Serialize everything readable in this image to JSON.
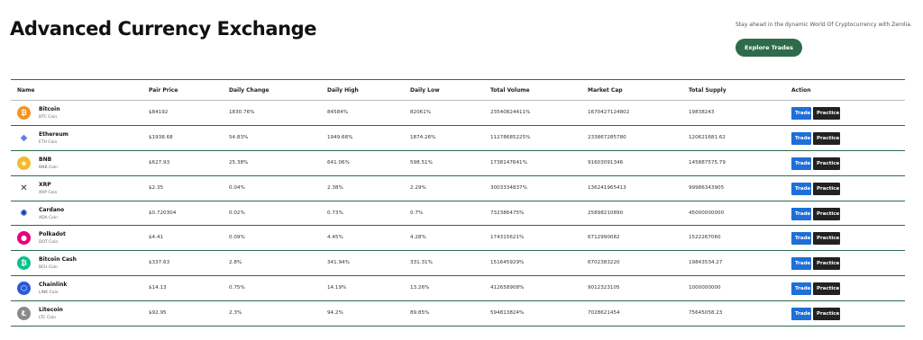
{
  "header": {
    "title": "Advanced Currency Exchange",
    "tagline": "Stay ahead in the dynamic World Of Cryptocurrency with Zerolia.",
    "explore_label": "Explore Trades"
  },
  "table": {
    "columns": [
      "Name",
      "Pair Price",
      "Daily Change",
      "Daily High",
      "Daily Low",
      "Total Volume",
      "Market Cap",
      "Total Supply",
      "Action"
    ],
    "trade_label": "Trade",
    "practice_label": "Practice",
    "rows": [
      {
        "name": "Bitcoin",
        "symbol": "BTC Coin",
        "icon": "bitcoin-icon",
        "color": "#f7931a",
        "glyph": "₿",
        "price": "$84192",
        "change": "1830.76%",
        "high": "84584%",
        "low": "82061%",
        "volume": "23540824411%",
        "cap": "1670427124802",
        "supply": "19838243"
      },
      {
        "name": "Ethereum",
        "symbol": "ETH Coin",
        "icon": "ethereum-icon",
        "color": "#ffffff",
        "glyph": "◆",
        "price": "$1938.68",
        "change": "54.83%",
        "high": "1949.66%",
        "low": "1874.26%",
        "volume": "11278685225%",
        "cap": "233867285780",
        "supply": "120621681.62"
      },
      {
        "name": "BNB",
        "symbol": "BNB Coin",
        "icon": "bnb-icon",
        "color": "#f3ba2f",
        "glyph": "◈",
        "price": "$627.93",
        "change": "25.38%",
        "high": "641.06%",
        "low": "598.51%",
        "volume": "1738147641%",
        "cap": "91603091346",
        "supply": "145887575.79"
      },
      {
        "name": "XRP",
        "symbol": "XRP Coin",
        "icon": "xrp-icon",
        "color": "#ffffff",
        "glyph": "✕",
        "price": "$2.35",
        "change": "0.04%",
        "high": "2.38%",
        "low": "2.29%",
        "volume": "3003334837%",
        "cap": "136241965413",
        "supply": "99986343905"
      },
      {
        "name": "Cardano",
        "symbol": "ADA Coin",
        "icon": "cardano-icon",
        "color": "#ffffff",
        "glyph": "✺",
        "price": "$0.720304",
        "change": "0.02%",
        "high": "0.73%",
        "low": "0.7%",
        "volume": "732386475%",
        "cap": "25898210890",
        "supply": "45000000000"
      },
      {
        "name": "Polkadot",
        "symbol": "DOT Coin",
        "icon": "polkadot-icon",
        "color": "#e6007a",
        "glyph": "●",
        "price": "$4.41",
        "change": "0.09%",
        "high": "4.45%",
        "low": "4.28%",
        "volume": "174315621%",
        "cap": "6712990082",
        "supply": "1522267060"
      },
      {
        "name": "Bitcoin Cash",
        "symbol": "BCH Coin",
        "icon": "bitcoin-cash-icon",
        "color": "#0ac18e",
        "glyph": "₿",
        "price": "$337.63",
        "change": "2.8%",
        "high": "341.94%",
        "low": "331.31%",
        "volume": "151645929%",
        "cap": "6702383220",
        "supply": "19843534.27"
      },
      {
        "name": "Chainlink",
        "symbol": "LINK Coin",
        "icon": "chainlink-icon",
        "color": "#2a5ada",
        "glyph": "⬡",
        "price": "$14.13",
        "change": "0.75%",
        "high": "14.19%",
        "low": "13.26%",
        "volume": "412658908%",
        "cap": "9012323105",
        "supply": "1000000000"
      },
      {
        "name": "Litecoin",
        "symbol": "LTC Coin",
        "icon": "litecoin-icon",
        "color": "#8a8a8a",
        "glyph": "Ł",
        "price": "$92.95",
        "change": "2.3%",
        "high": "94.2%",
        "low": "89.85%",
        "volume": "594813824%",
        "cap": "7028621454",
        "supply": "75645058.23"
      }
    ]
  }
}
